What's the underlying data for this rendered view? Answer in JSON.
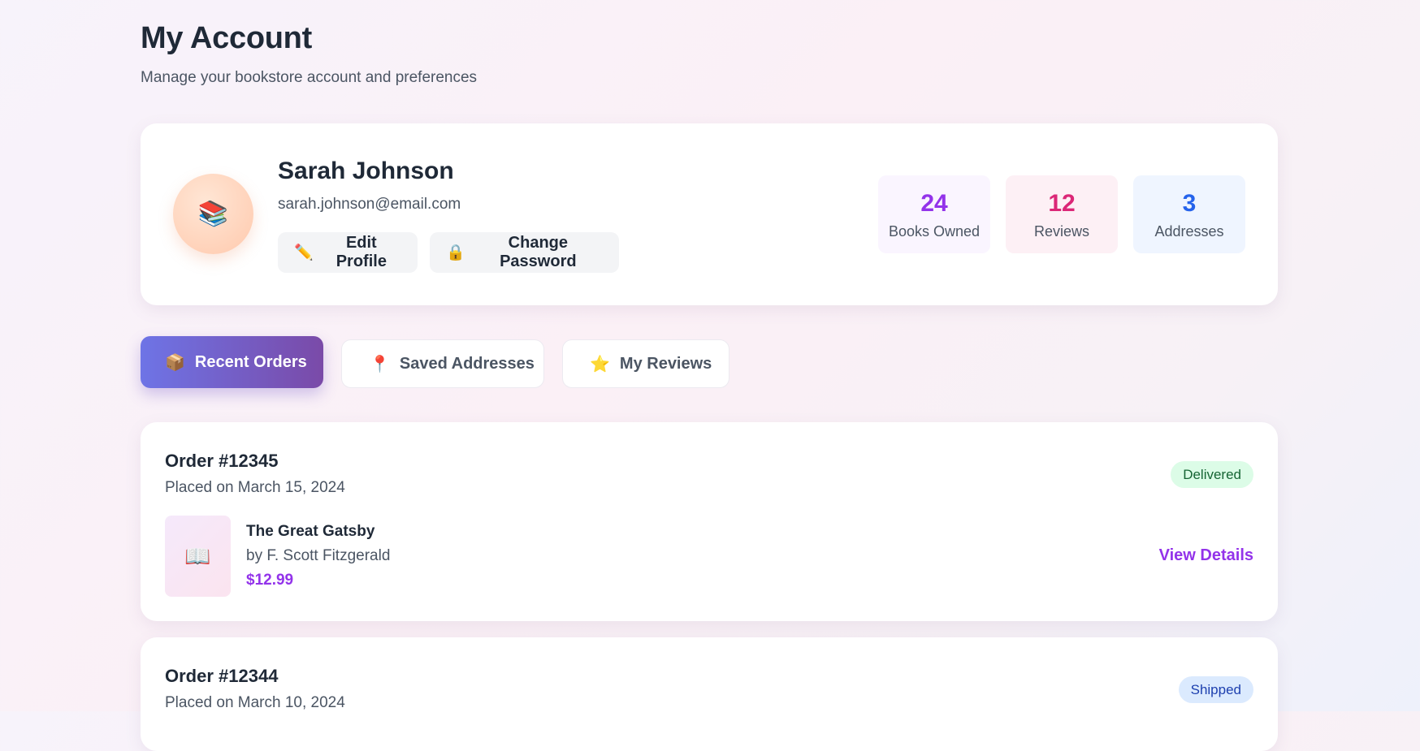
{
  "header": {
    "title": "My Account",
    "subtitle": "Manage your bookstore account and preferences"
  },
  "profile": {
    "avatar_icon": "books-icon",
    "avatar_glyph": "📚",
    "name": "Sarah Johnson",
    "email": "sarah.johnson@email.com",
    "edit_button": {
      "icon": "pencil-icon",
      "glyph": "✏️",
      "label": "Edit Profile"
    },
    "password_button": {
      "icon": "lock-icon",
      "glyph": "🔒",
      "label": "Change Password"
    }
  },
  "stats": [
    {
      "value": "24",
      "label": "Books Owned",
      "color": "#9333ea"
    },
    {
      "value": "12",
      "label": "Reviews",
      "color": "#db2777"
    },
    {
      "value": "3",
      "label": "Addresses",
      "color": "#2563eb"
    }
  ],
  "tabs": [
    {
      "label": "Recent Orders",
      "icon": "package-icon",
      "glyph": "📦",
      "active": true
    },
    {
      "label": "Saved Addresses",
      "icon": "pin-icon",
      "glyph": "📍",
      "active": false
    },
    {
      "label": "My Reviews",
      "icon": "star-icon",
      "glyph": "⭐",
      "active": false
    }
  ],
  "orders": [
    {
      "title": "Order #12345",
      "date": "Placed on March 15, 2024",
      "status": "Delivered",
      "item": {
        "icon": "open-book-icon",
        "glyph": "📖",
        "title": "The Great Gatsby",
        "author": "by F. Scott Fitzgerald",
        "price": "$12.99"
      },
      "action": "View Details"
    },
    {
      "title": "Order #12344",
      "date": "Placed on March 10, 2024",
      "status": "Shipped"
    }
  ],
  "colors": {
    "accent": "#9333ea",
    "tab_active_start": "#6e74e6",
    "tab_active_end": "#7a4aa8",
    "delivered_bg": "#dcfce7",
    "delivered_text": "#166534",
    "shipped_bg": "#dbeafe",
    "shipped_text": "#1e40af"
  }
}
